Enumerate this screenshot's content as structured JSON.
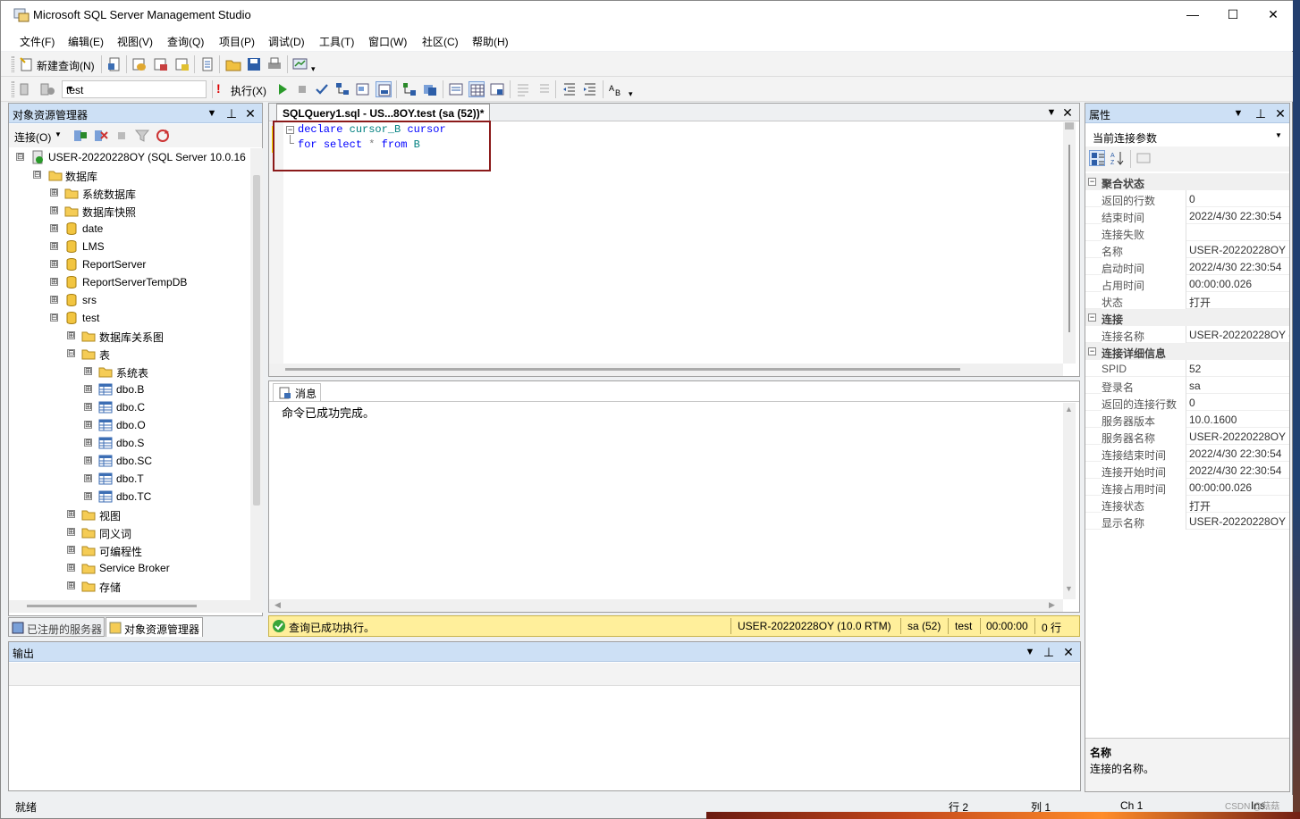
{
  "window": {
    "title": "Microsoft SQL Server Management Studio"
  },
  "menu": [
    "文件(F)",
    "编辑(E)",
    "视图(V)",
    "查询(Q)",
    "项目(P)",
    "调试(D)",
    "工具(T)",
    "窗口(W)",
    "社区(C)",
    "帮助(H)"
  ],
  "toolbar1": {
    "new_query": "新建查询(N)"
  },
  "toolbar2": {
    "database": "test",
    "execute": "执行(X)"
  },
  "object_explorer": {
    "title": "对象资源管理器",
    "connect": "连接(O)",
    "nodes": [
      {
        "label": "USER-20220228OY (SQL Server 10.0.16",
        "exp": "⊟",
        "icon": "server-icon"
      },
      {
        "label": "数据库",
        "exp": "⊟",
        "icon": "folder-icon"
      },
      {
        "label": "系统数据库",
        "exp": "⊞",
        "icon": "folder-icon"
      },
      {
        "label": "数据库快照",
        "exp": "⊞",
        "icon": "folder-icon"
      },
      {
        "label": "date",
        "exp": "⊞",
        "icon": "database-icon"
      },
      {
        "label": "LMS",
        "exp": "⊞",
        "icon": "database-icon"
      },
      {
        "label": "ReportServer",
        "exp": "⊞",
        "icon": "database-icon"
      },
      {
        "label": "ReportServerTempDB",
        "exp": "⊞",
        "icon": "database-icon"
      },
      {
        "label": "srs",
        "exp": "⊞",
        "icon": "database-icon"
      },
      {
        "label": "test",
        "exp": "⊟",
        "icon": "database-icon"
      },
      {
        "label": "数据库关系图",
        "exp": "⊞",
        "icon": "folder-icon"
      },
      {
        "label": "表",
        "exp": "⊟",
        "icon": "folder-icon"
      },
      {
        "label": "系统表",
        "exp": "⊞",
        "icon": "folder-icon"
      },
      {
        "label": "dbo.B",
        "exp": "⊞",
        "icon": "table-icon"
      },
      {
        "label": "dbo.C",
        "exp": "⊞",
        "icon": "table-icon"
      },
      {
        "label": "dbo.O",
        "exp": "⊞",
        "icon": "table-icon"
      },
      {
        "label": "dbo.S",
        "exp": "⊞",
        "icon": "table-icon"
      },
      {
        "label": "dbo.SC",
        "exp": "⊞",
        "icon": "table-icon"
      },
      {
        "label": "dbo.T",
        "exp": "⊞",
        "icon": "table-icon"
      },
      {
        "label": "dbo.TC",
        "exp": "⊞",
        "icon": "table-icon"
      },
      {
        "label": "视图",
        "exp": "⊞",
        "icon": "folder-icon"
      },
      {
        "label": "同义词",
        "exp": "⊞",
        "icon": "folder-icon"
      },
      {
        "label": "可编程性",
        "exp": "⊞",
        "icon": "folder-icon"
      },
      {
        "label": "Service Broker",
        "exp": "⊞",
        "icon": "folder-icon"
      },
      {
        "label": "存储",
        "exp": "⊞",
        "icon": "folder-icon"
      }
    ],
    "tabs": [
      "已注册的服务器",
      "对象资源管理器"
    ]
  },
  "editor": {
    "tab": "SQLQuery1.sql - US...8OY.test (sa (52))*",
    "lines": [
      [
        "declare",
        "cursor_B",
        "cursor"
      ],
      [
        "for",
        "select",
        "*",
        "from",
        "B"
      ]
    ]
  },
  "messages": {
    "tab": "消息",
    "text": "命令已成功完成。"
  },
  "query_status": {
    "text": "查询已成功执行。",
    "server": "USER-20220228OY (10.0 RTM)",
    "user": "sa (52)",
    "db": "test",
    "time": "00:00:00",
    "rows": "0 行"
  },
  "output": {
    "title": "输出"
  },
  "properties": {
    "title": "属性",
    "selector": "当前连接参数",
    "sections": [
      {
        "name": "聚合状态",
        "rows": [
          {
            "k": "返回的行数",
            "v": "0"
          },
          {
            "k": "结束时间",
            "v": "2022/4/30 22:30:54"
          },
          {
            "k": "连接失败",
            "v": ""
          },
          {
            "k": "名称",
            "v": "USER-20220228OY"
          },
          {
            "k": "启动时间",
            "v": "2022/4/30 22:30:54"
          },
          {
            "k": "占用时间",
            "v": "00:00:00.026"
          },
          {
            "k": "状态",
            "v": "打开"
          }
        ]
      },
      {
        "name": "连接",
        "rows": [
          {
            "k": "连接名称",
            "v": "USER-20220228OY ("
          }
        ]
      },
      {
        "name": "连接详细信息",
        "rows": [
          {
            "k": "SPID",
            "v": "52"
          },
          {
            "k": "登录名",
            "v": "sa"
          },
          {
            "k": "返回的连接行数",
            "v": "0"
          },
          {
            "k": "服务器版本",
            "v": "10.0.1600"
          },
          {
            "k": "服务器名称",
            "v": "USER-20220228OY"
          },
          {
            "k": "连接结束时间",
            "v": "2022/4/30 22:30:54"
          },
          {
            "k": "连接开始时间",
            "v": "2022/4/30 22:30:54"
          },
          {
            "k": "连接占用时间",
            "v": "00:00:00.026"
          },
          {
            "k": "连接状态",
            "v": "打开"
          },
          {
            "k": "显示名称",
            "v": "USER-20220228OY"
          }
        ]
      }
    ],
    "desc_title": "名称",
    "desc_text": "连接的名称。"
  },
  "statusbar": {
    "ready": "就绪",
    "line": "行 2",
    "col": "列 1",
    "ch": "Ch 1",
    "ins": "Ins"
  },
  "watermark": "CSDN @菇菇"
}
